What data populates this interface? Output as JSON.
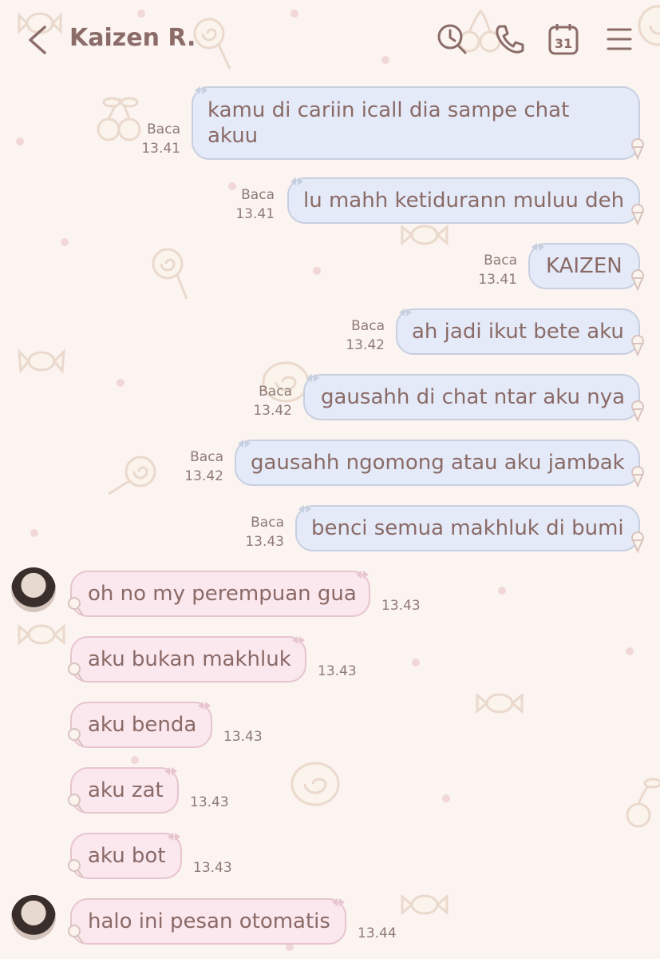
{
  "header": {
    "contact_name": "Kaizen R.",
    "icons": [
      "back-chevron-icon",
      "search-history-icon",
      "phone-icon",
      "calendar-icon",
      "menu-icon"
    ],
    "calendar_day": "31"
  },
  "colors": {
    "background": "#fbf4f1",
    "sent_bubble": "#e4eaf8",
    "received_bubble": "#fbe7ee",
    "text": "#8a6a66"
  },
  "messages": [
    {
      "direction": "sent",
      "text": "kamu di cariin icall dia sampe chat akuu",
      "status": "Baca",
      "time": "13.41"
    },
    {
      "direction": "sent",
      "text": "lu mahh ketidurann muluu deh",
      "status": "Baca",
      "time": "13.41"
    },
    {
      "direction": "sent",
      "text": "KAIZEN",
      "status": "Baca",
      "time": "13.41"
    },
    {
      "direction": "sent",
      "text": "ah jadi ikut bete aku",
      "status": "Baca",
      "time": "13.42"
    },
    {
      "direction": "sent",
      "text": "gausahh di chat ntar aku nya",
      "status": "Baca",
      "time": "13.42"
    },
    {
      "direction": "sent",
      "text": "gausahh ngomong atau aku jambak",
      "status": "Baca",
      "time": "13.42"
    },
    {
      "direction": "sent",
      "text": "benci semua makhluk di bumi",
      "status": "Baca",
      "time": "13.43"
    },
    {
      "direction": "received",
      "text": "oh no my perempuan gua",
      "time": "13.43"
    },
    {
      "direction": "received",
      "text": "aku bukan makhluk",
      "time": "13.43"
    },
    {
      "direction": "received",
      "text": "aku benda",
      "time": "13.43"
    },
    {
      "direction": "received",
      "text": "aku zat",
      "time": "13.43"
    },
    {
      "direction": "received",
      "text": "aku bot",
      "time": "13.43"
    },
    {
      "direction": "received",
      "text": "halo ini pesan otomatis",
      "time": "13.44"
    }
  ]
}
